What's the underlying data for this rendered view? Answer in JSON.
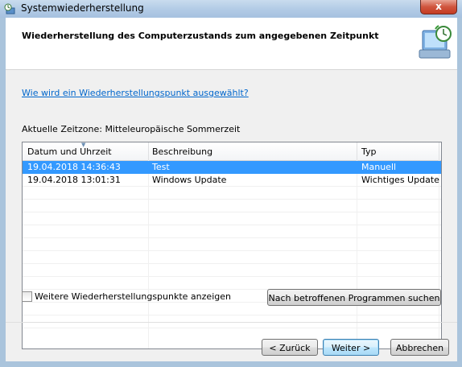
{
  "window": {
    "title": "Systemwiederherstellung",
    "close_label": "x"
  },
  "header": {
    "heading": "Wiederherstellung des Computerzustands zum angegebenen Zeitpunkt",
    "icon": "system-restore-icon"
  },
  "help_link": "Wie wird ein Wiederherstellungspunkt ausgewählt?",
  "timezone": "Aktuelle Zeitzone: Mitteleuropäische Sommerzeit",
  "table": {
    "columns": [
      "Datum und Uhrzeit",
      "Beschreibung",
      "Typ"
    ],
    "rows": [
      {
        "date": "19.04.2018 14:36:43",
        "description": "Test",
        "type": "Manuell",
        "selected": true
      },
      {
        "date": "19.04.2018 13:01:31",
        "description": "Windows Update",
        "type": "Wichtiges Update",
        "selected": false
      }
    ]
  },
  "more_points": {
    "label": "Weitere Wiederherstellungspunkte anzeigen",
    "checked": false
  },
  "scan_button": "Nach betroffenen Programmen suchen",
  "buttons": {
    "back": "< Zurück",
    "next": "Weiter >",
    "cancel": "Abbrechen"
  },
  "colors": {
    "selection": "#3399ff",
    "link": "#0066cc",
    "close": "#c53b22"
  }
}
